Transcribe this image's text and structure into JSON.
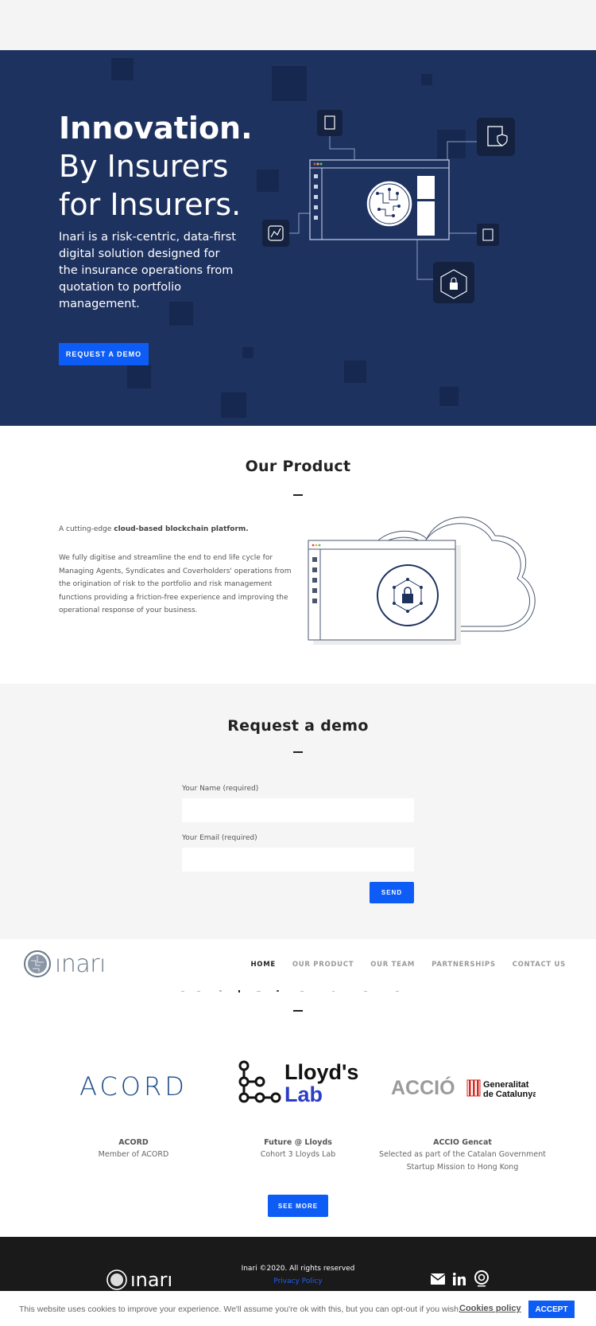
{
  "hero": {
    "title_line1": "Innovation.",
    "title_line2": "By Insurers",
    "title_line3": "for Insurers.",
    "description": "Inari is a risk-centric, data-first digital solution designed for the insurance operations from quotation to portfolio management.",
    "cta_label": "REQUEST A DEMO"
  },
  "product": {
    "title": "Our Product",
    "intro_prefix": "A cutting-edge ",
    "intro_bold": "cloud-based blockchain platform.",
    "body": "We fully digitise and streamline the end to end life cycle for Managing Agents, Syndicates and Coverholders' operations from the origination of risk to the portfolio and risk management functions providing a friction-free experience and improving the operational response of your business."
  },
  "demo": {
    "title": "Request a demo",
    "name_label": "Your Name (required)",
    "email_label": "Your Email (required)",
    "send_label": "SEND"
  },
  "nav": {
    "brand": "ınarı",
    "items": [
      "HOME",
      "OUR PRODUCT",
      "OUR TEAM",
      "PARTNERSHIPS",
      "CONTACT US"
    ]
  },
  "partners": {
    "items": [
      {
        "logo_text": "ACORD",
        "name": "ACORD",
        "desc": "Member of ACORD"
      },
      {
        "logo_text_1": "Lloyd's",
        "logo_text_2": "Lab",
        "name": "Future @ Lloyds",
        "desc": "Cohort 3 Lloyds Lab"
      },
      {
        "logo_text": "ACCIÓ",
        "logo_sub_1": "Generalitat",
        "logo_sub_2": "de Catalunya",
        "name": "ACCIO Gencat",
        "desc_line1": "Selected as part of the Catalan Government",
        "desc_line2": "Startup Mission to Hong Kong"
      }
    ],
    "see_more_label": "SEE MORE"
  },
  "footer": {
    "brand": "ınarı",
    "copyright": "Inari ©2020. All rights reserved",
    "privacy": "Privacy Policy",
    "icons": [
      "envelope-icon",
      "linkedin-icon",
      "award-badge-icon"
    ]
  },
  "cookie": {
    "text": "This website uses cookies to improve your experience. We'll assume you're ok with this, but you can opt-out if you wish.",
    "policy_label": "Cookies policy",
    "accept_label": "ACCEPT"
  },
  "colors": {
    "hero_bg": "#1e3260",
    "accent": "#0d5cf5",
    "footer_bg": "#1a1a1a"
  }
}
